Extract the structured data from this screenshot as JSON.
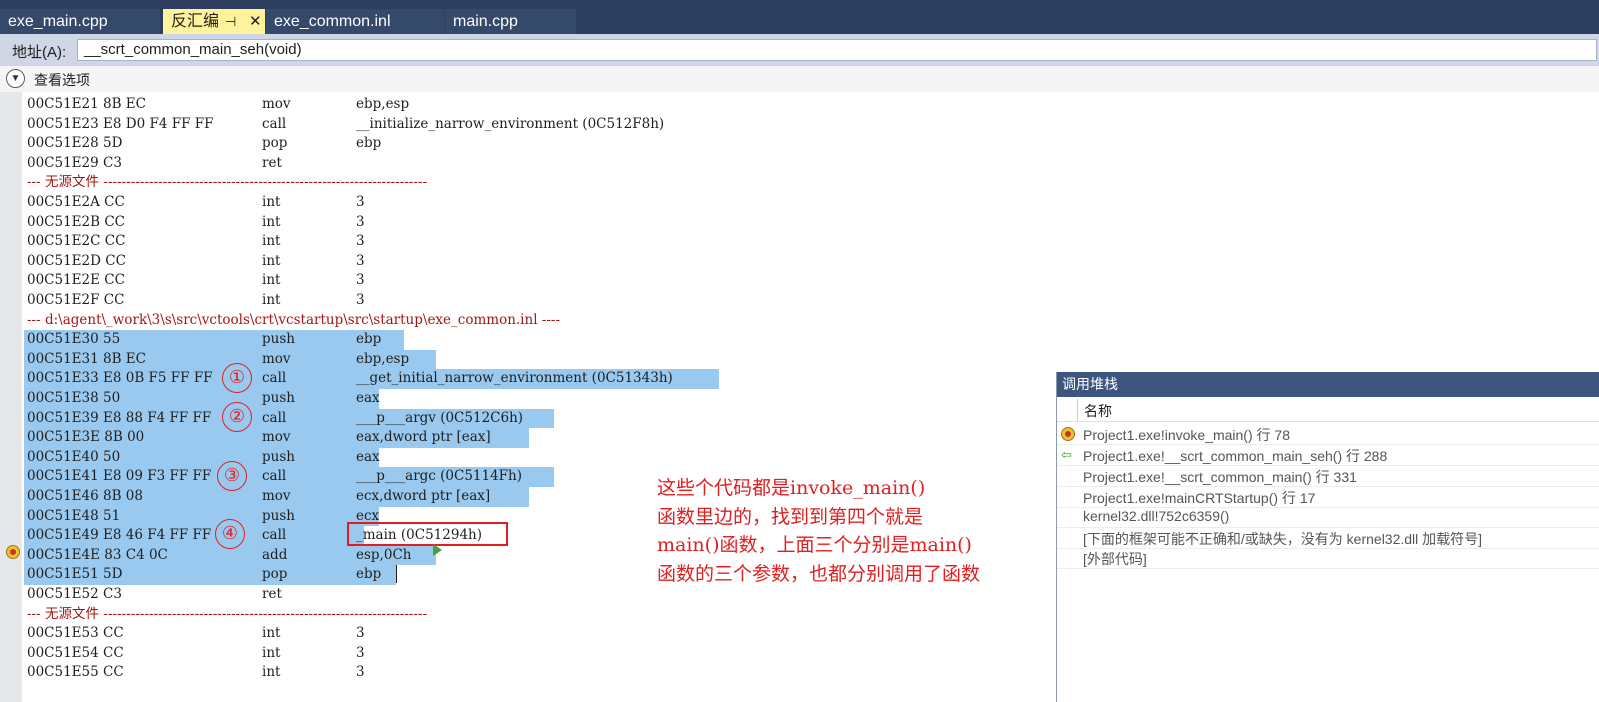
{
  "tabs": [
    {
      "label": "exe_main.cpp"
    },
    {
      "label": "反汇编",
      "pin": "⊣",
      "close": "✕"
    },
    {
      "label": "exe_common.inl"
    },
    {
      "label": "main.cpp"
    }
  ],
  "address_bar": {
    "label": "地址(A):",
    "value": "__scrt_common_main_seh(void)"
  },
  "options": {
    "label": "查看选项",
    "icon": "chevron-down-icon"
  },
  "code_lines": [
    {
      "addr": "00C51E21 8B EC",
      "mn": "mov",
      "op": "ebp,esp"
    },
    {
      "addr": "00C51E23 E8 D0 F4 FF FF",
      "mn": "call",
      "op": "__initialize_narrow_environment (0C512F8h)"
    },
    {
      "addr": "00C51E28 5D",
      "mn": "pop",
      "op": "ebp"
    },
    {
      "addr": "00C51E29 C3",
      "mn": "ret",
      "op": ""
    },
    {
      "text": "--- 无源文件 -----------------------------------------------------------------------"
    },
    {
      "addr": "00C51E2A CC",
      "mn": "int",
      "op": "3"
    },
    {
      "addr": "00C51E2B CC",
      "mn": "int",
      "op": "3"
    },
    {
      "addr": "00C51E2C CC",
      "mn": "int",
      "op": "3"
    },
    {
      "addr": "00C51E2D CC",
      "mn": "int",
      "op": "3"
    },
    {
      "addr": "00C51E2E CC",
      "mn": "int",
      "op": "3"
    },
    {
      "addr": "00C51E2F CC",
      "mn": "int",
      "op": "3"
    },
    {
      "text": "--- d:\\agent\\_work\\3\\s\\src\\vctools\\crt\\vcstartup\\src\\startup\\exe_common.inl ----"
    },
    {
      "addr": "00C51E30 55",
      "mn": "push",
      "op": "ebp"
    },
    {
      "addr": "00C51E31 8B EC",
      "mn": "mov",
      "op": "ebp,esp"
    },
    {
      "addr": "00C51E33 E8 0B F5 FF FF",
      "mn": "call",
      "op": "__get_initial_narrow_environment (0C51343h)"
    },
    {
      "addr": "00C51E38 50",
      "mn": "push",
      "op": "eax"
    },
    {
      "addr": "00C51E39 E8 88 F4 FF FF",
      "mn": "call",
      "op": "___p___argv (0C512C6h)"
    },
    {
      "addr": "00C51E3E 8B 00",
      "mn": "mov",
      "op": "eax,dword ptr [eax]"
    },
    {
      "addr": "00C51E40 50",
      "mn": "push",
      "op": "eax"
    },
    {
      "addr": "00C51E41 E8 09 F3 FF FF",
      "mn": "call",
      "op": "___p___argc (0C5114Fh)"
    },
    {
      "addr": "00C51E46 8B 08",
      "mn": "mov",
      "op": "ecx,dword ptr [eax]"
    },
    {
      "addr": "00C51E48 51",
      "mn": "push",
      "op": "ecx"
    },
    {
      "addr": "00C51E49 E8 46 F4 FF FF",
      "mn": "call",
      "op": "_main (0C51294h)"
    },
    {
      "addr": "00C51E4E 83 C4 0C",
      "mn": "add",
      "op": "esp,0Ch"
    },
    {
      "addr": "00C51E51 5D",
      "mn": "pop",
      "op": "ebp"
    },
    {
      "addr": "00C51E52 C3",
      "mn": "ret",
      "op": ""
    },
    {
      "text": "--- 无源文件 -----------------------------------------------------------------------"
    },
    {
      "addr": "00C51E53 CC",
      "mn": "int",
      "op": "3"
    },
    {
      "addr": "00C51E54 CC",
      "mn": "int",
      "op": "3"
    },
    {
      "addr": "00C51E55 CC",
      "mn": "int",
      "op": "3"
    }
  ],
  "circle_labels": [
    "①",
    "②",
    "③",
    "④"
  ],
  "annotation": [
    "这些个代码都是invoke_main()",
    "函数里边的，找到到第四个就是",
    "main()函数，上面三个分别是main()",
    "函数的三个参数，也都分别调用了函数"
  ],
  "call_stack": {
    "title": "调用堆栈",
    "column": "名称",
    "rows": [
      {
        "icon": "current-frame-icon",
        "text": "Project1.exe!invoke_main() 行 78"
      },
      {
        "icon": "return-arrow-icon",
        "text": "Project1.exe!__scrt_common_main_seh() 行 288"
      },
      {
        "icon": "",
        "text": "Project1.exe!__scrt_common_main() 行 331"
      },
      {
        "icon": "",
        "text": "Project1.exe!mainCRTStartup() 行 17"
      },
      {
        "icon": "",
        "text": "kernel32.dll!752c6359()"
      },
      {
        "icon": "",
        "text": "[下面的框架可能不正确和/或缺失，没有为 kernel32.dll 加载符号]"
      },
      {
        "icon": "",
        "text": "[外部代码]"
      }
    ]
  }
}
